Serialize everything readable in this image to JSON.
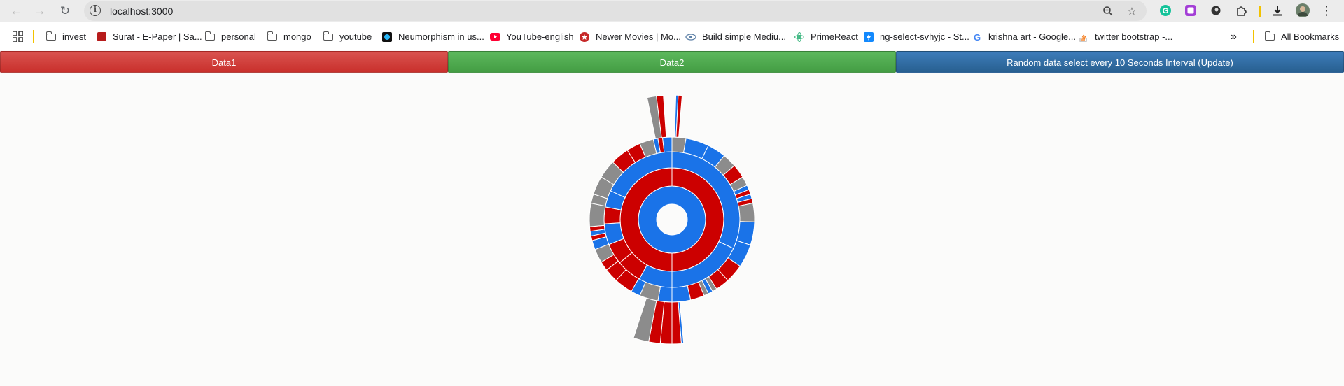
{
  "browser": {
    "url": "localhost:3000",
    "bookmarks": [
      {
        "label": "invest",
        "icon": "folder-icon"
      },
      {
        "label": "Surat - E-Paper | Sa...",
        "icon": "epaper-icon",
        "color": "#b71c1c"
      },
      {
        "label": "personal",
        "icon": "folder-icon"
      },
      {
        "label": "mongo",
        "icon": "folder-icon"
      },
      {
        "label": "youtube",
        "icon": "folder-icon"
      },
      {
        "label": "Neumorphism in us...",
        "icon": "neumorphism-icon",
        "color": "#111111"
      },
      {
        "label": "YouTube-english",
        "icon": "youtube-icon",
        "color": "#ff0033"
      },
      {
        "label": "Newer Movies | Mo...",
        "icon": "movies-icon",
        "color": "#c62828"
      },
      {
        "label": "Build simple Mediu...",
        "icon": "eye-icon",
        "color": "#5b7fa6"
      },
      {
        "label": "PrimeReact",
        "icon": "primereact-icon",
        "color": "#41b883"
      },
      {
        "label": "ng-select-svhyjc - St...",
        "icon": "stackblitz-icon",
        "color": "#1389fd"
      },
      {
        "label": "krishna art - Google...",
        "icon": "google-icon",
        "color": "#4285f4"
      },
      {
        "label": "twitter bootstrap -...",
        "icon": "stackoverflow-icon",
        "color": "#f48024"
      }
    ],
    "all_bookmarks": "All Bookmarks",
    "overflow": "»"
  },
  "app": {
    "buttons": {
      "data1": "Data1",
      "data2": "Data2",
      "random": "Random data select every 10 Seconds Interval (Update)"
    }
  },
  "colors": {
    "red": "#cc0000",
    "blue": "#1a73e8",
    "gray": "#8c8c8c"
  },
  "chart_data": {
    "type": "sunburst",
    "rings": [
      [
        {
          "value": 100,
          "color": "blue"
        }
      ],
      [
        {
          "value": 50,
          "color": "red"
        },
        {
          "value": 50,
          "color": "red"
        }
      ],
      [
        {
          "value": 32,
          "color": "blue"
        },
        {
          "value": 18,
          "color": "blue"
        },
        {
          "value": 8,
          "color": "blue"
        },
        {
          "value": 6,
          "color": "red"
        },
        {
          "value": 5,
          "color": "red"
        },
        {
          "value": 5,
          "color": "blue"
        },
        {
          "value": 4,
          "color": "red"
        },
        {
          "value": 4,
          "color": "blue"
        },
        {
          "value": 18,
          "color": "blue"
        }
      ],
      [
        {
          "value": 3,
          "color": "gray"
        },
        {
          "value": 5,
          "color": "blue"
        },
        {
          "value": 4,
          "color": "blue"
        },
        {
          "value": 3,
          "color": "gray"
        },
        {
          "value": 3,
          "color": "red"
        },
        {
          "value": 2,
          "color": "gray"
        },
        {
          "value": 1,
          "color": "blue"
        },
        {
          "value": 1,
          "color": "red"
        },
        {
          "value": 1,
          "color": "blue"
        },
        {
          "value": 1,
          "color": "red"
        },
        {
          "value": 4,
          "color": "gray"
        },
        {
          "value": 5,
          "color": "blue"
        },
        {
          "value": 5,
          "color": "blue"
        },
        {
          "value": 4,
          "color": "red"
        },
        {
          "value": 3,
          "color": "red"
        },
        {
          "value": 1,
          "color": "gray"
        },
        {
          "value": 1,
          "color": "blue"
        },
        {
          "value": 1,
          "color": "gray"
        },
        {
          "value": 3,
          "color": "red"
        },
        {
          "value": 4,
          "color": "blue"
        },
        {
          "value": 3,
          "color": "blue"
        },
        {
          "value": 4,
          "color": "gray"
        },
        {
          "value": 2,
          "color": "blue"
        },
        {
          "value": 4,
          "color": "red"
        },
        {
          "value": 3,
          "color": "red"
        },
        {
          "value": 2,
          "color": "red"
        },
        {
          "value": 3,
          "color": "gray"
        },
        {
          "value": 2,
          "color": "blue"
        },
        {
          "value": 1,
          "color": "red"
        },
        {
          "value": 1,
          "color": "blue"
        },
        {
          "value": 1,
          "color": "red"
        },
        {
          "value": 5,
          "color": "gray"
        },
        {
          "value": 2,
          "color": "gray"
        },
        {
          "value": 4,
          "color": "gray"
        },
        {
          "value": 4,
          "color": "gray"
        },
        {
          "value": 4,
          "color": "red"
        },
        {
          "value": 3,
          "color": "red"
        },
        {
          "value": 3,
          "color": "gray"
        },
        {
          "value": 1,
          "color": "blue"
        },
        {
          "value": 1,
          "color": "red"
        },
        {
          "value": 2,
          "color": "blue"
        }
      ],
      [
        {
          "start": 0.5,
          "value": 0.3,
          "color": "blue"
        },
        {
          "start": 0.8,
          "value": 0.5,
          "color": "red"
        },
        {
          "start": 48.5,
          "value": 0.3,
          "color": "blue"
        },
        {
          "start": 48.8,
          "value": 1.2,
          "color": "red"
        },
        {
          "start": 50.0,
          "value": 1.5,
          "color": "red"
        },
        {
          "start": 51.5,
          "value": 1.5,
          "color": "red"
        },
        {
          "start": 53.0,
          "value": 2.0,
          "color": "gray"
        },
        {
          "start": 96.8,
          "value": 1.2,
          "color": "gray"
        },
        {
          "start": 98.0,
          "value": 0.9,
          "color": "red"
        }
      ]
    ]
  }
}
